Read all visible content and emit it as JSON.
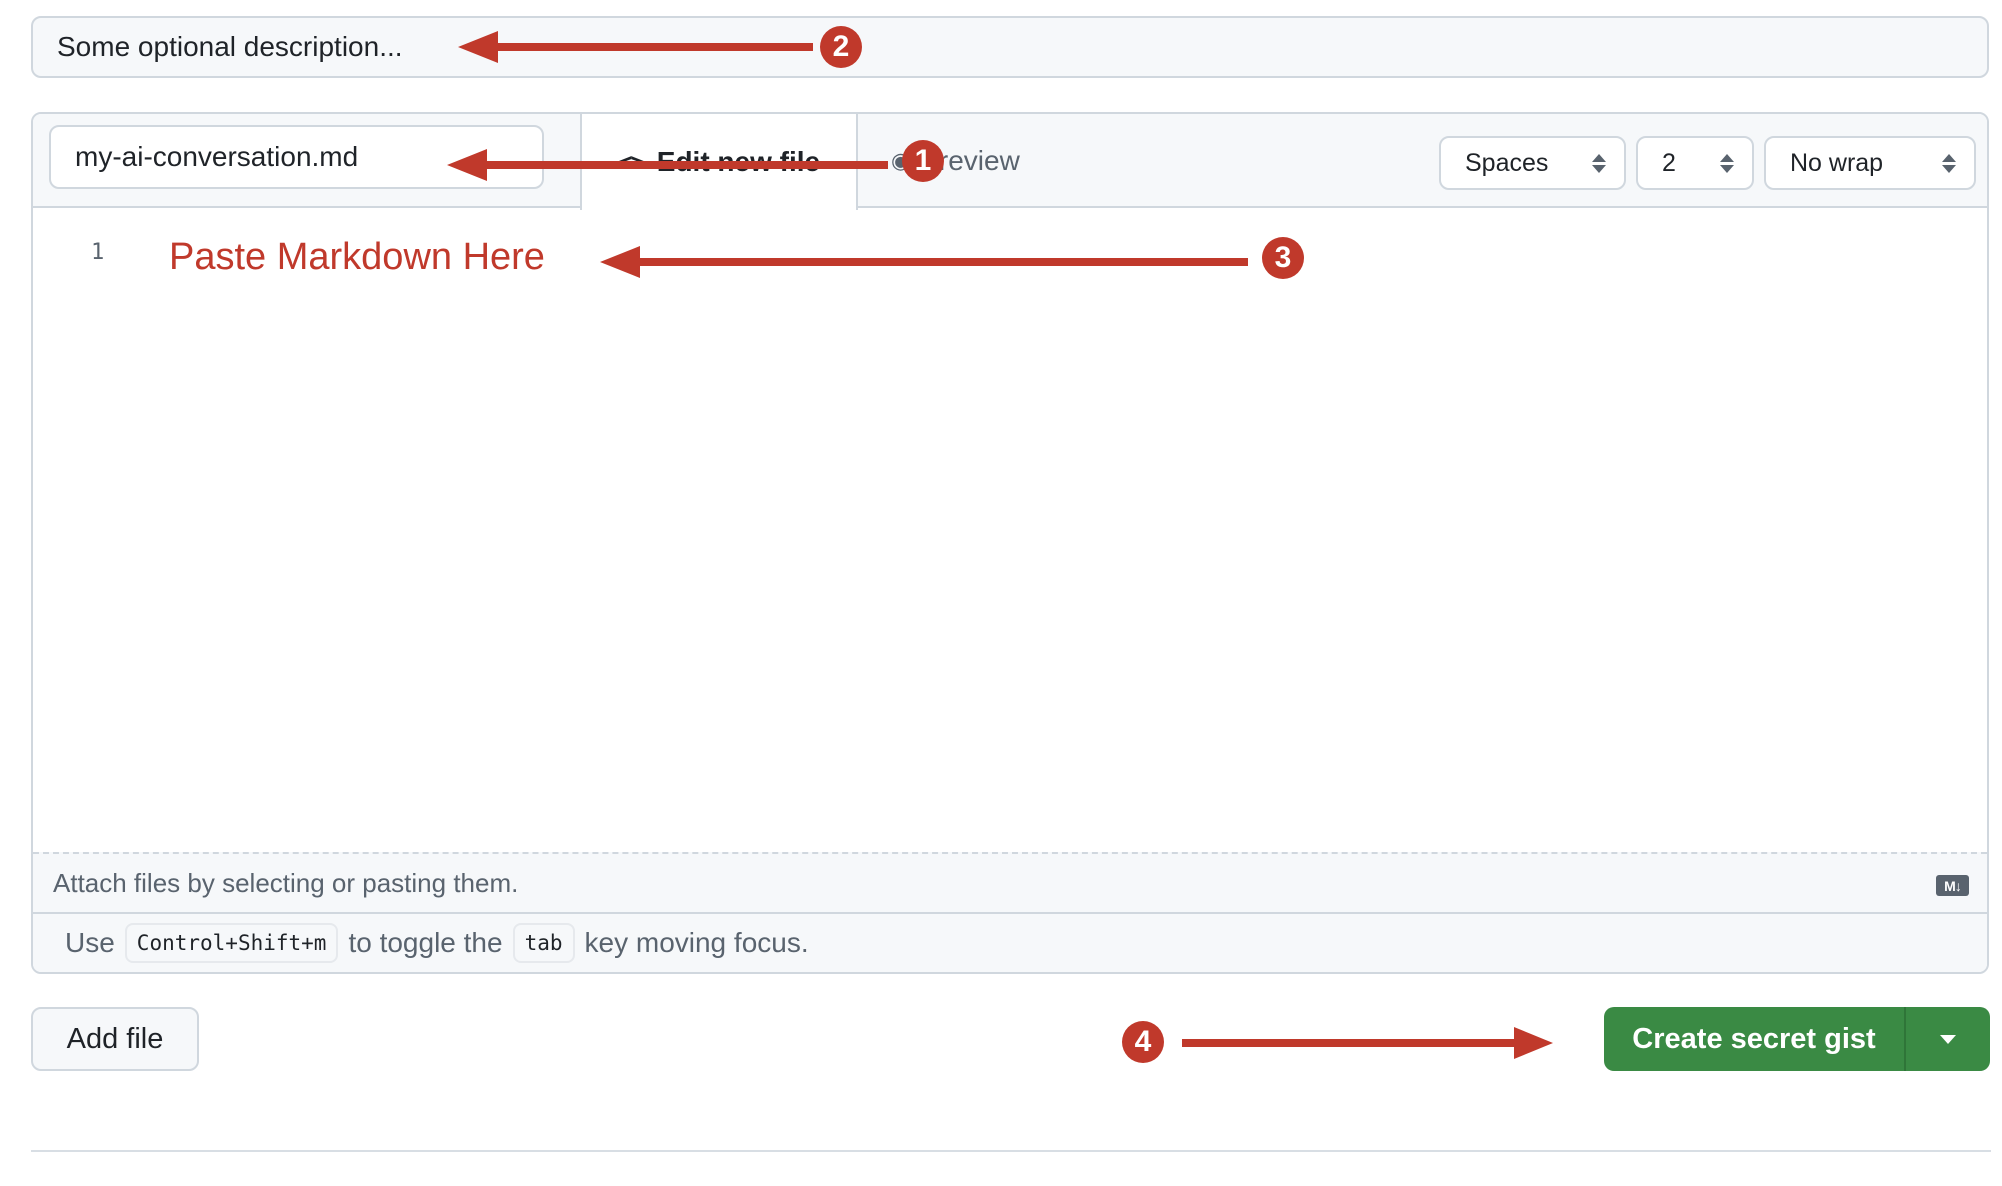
{
  "description": {
    "placeholder": "Some optional description..."
  },
  "editor": {
    "filename": "my-ai-conversation.md",
    "tabs": [
      {
        "label": "Edit new file",
        "icon": "code-icon",
        "active": true
      },
      {
        "label": "Preview",
        "icon": "eye-icon",
        "active": false
      }
    ],
    "selects": {
      "indent_mode": "Spaces",
      "indent_size": "2",
      "wrap_mode": "No wrap"
    },
    "lines": [
      {
        "number": "1",
        "text": "Paste Markdown Here"
      }
    ],
    "attach_text": "Attach files by selecting or pasting them.",
    "markdown_badge": "M↓",
    "hint": {
      "prefix": "Use",
      "shortcut": "Control+Shift+m",
      "middle": "to toggle the",
      "key": "tab",
      "suffix": "key moving focus."
    }
  },
  "actions": {
    "add_file_label": "Add file",
    "create_label": "Create secret gist"
  },
  "annotations": [
    {
      "number": "1",
      "target": "filename-input"
    },
    {
      "number": "2",
      "target": "description-input"
    },
    {
      "number": "3",
      "target": "code-editor"
    },
    {
      "number": "4",
      "target": "create-secret-gist-button"
    }
  ],
  "colors": {
    "annotation": "#c0392b",
    "primary_button": "#3a8a44",
    "border": "#d0d7de",
    "muted_text": "#59636e"
  }
}
